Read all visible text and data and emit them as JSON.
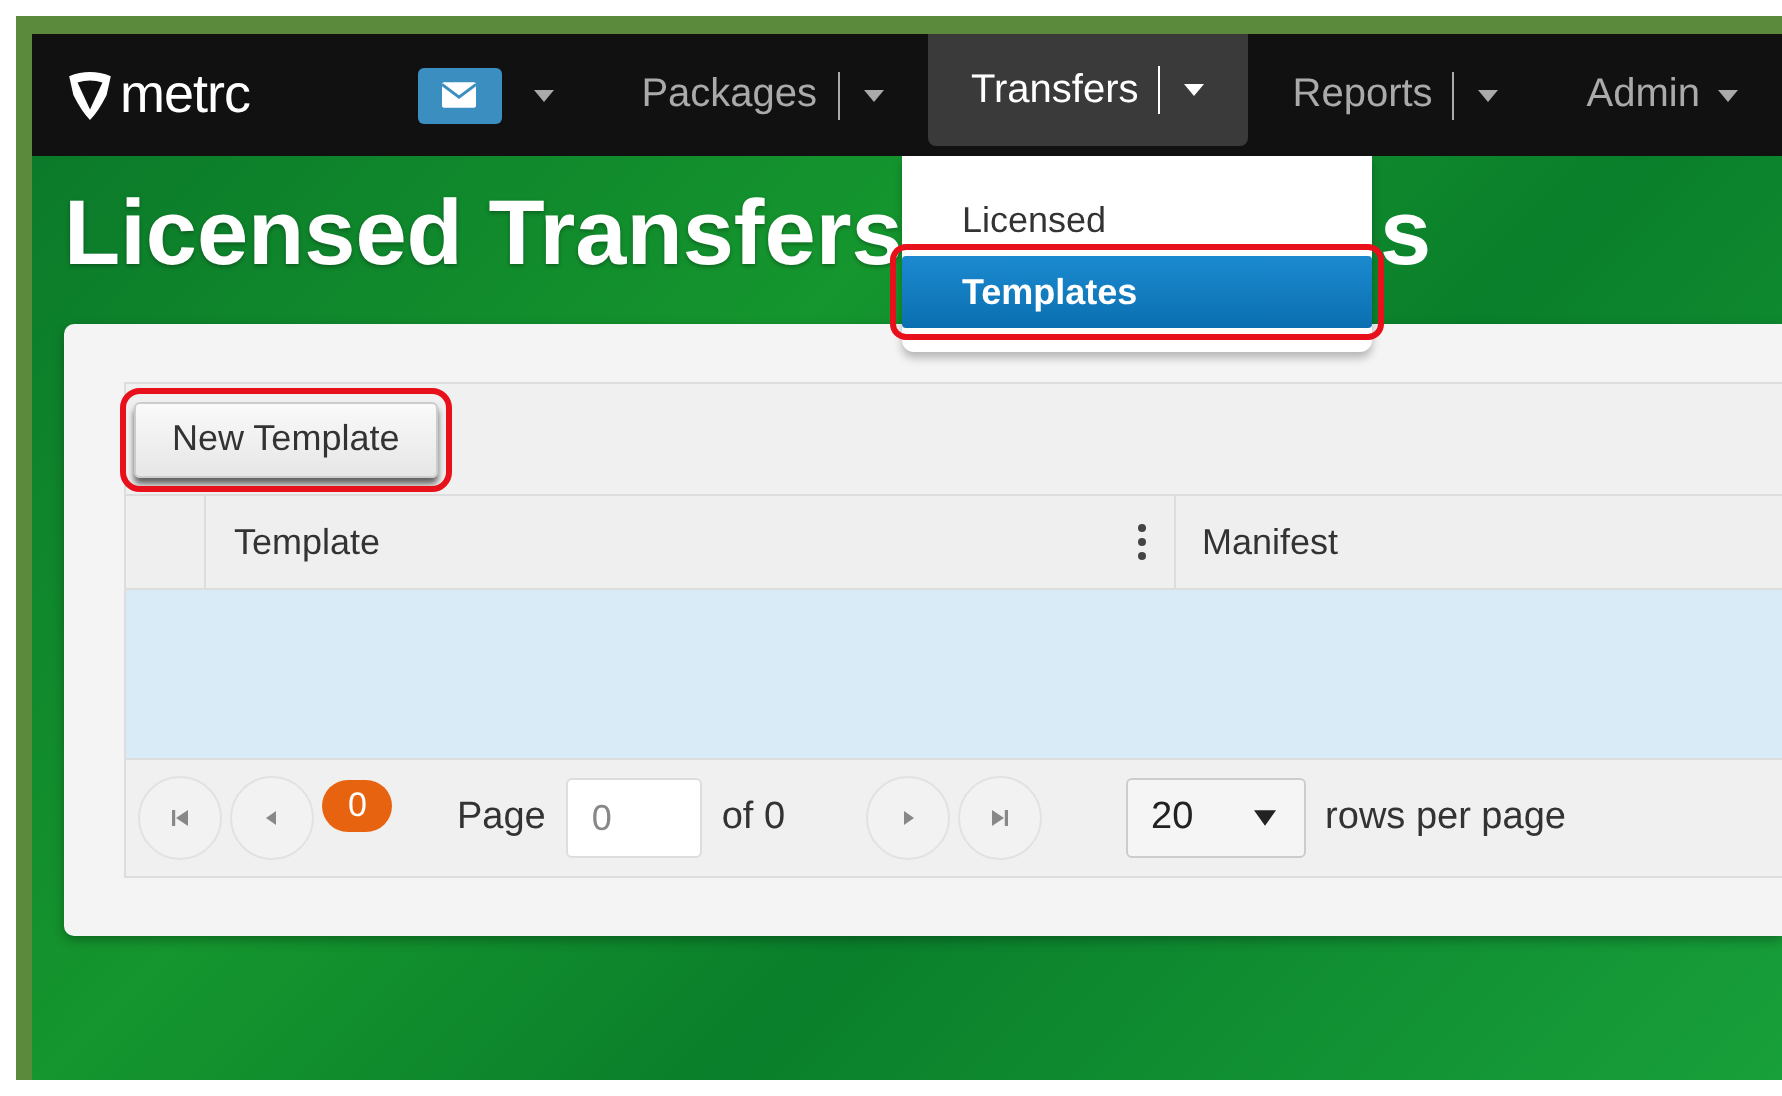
{
  "navbar": {
    "logo": "metrc",
    "items": [
      {
        "kind": "mail"
      },
      {
        "kind": "menu",
        "label": "Packages",
        "has_split": true,
        "selected": false
      },
      {
        "kind": "menu",
        "label": "Transfers",
        "has_split": true,
        "selected": true
      },
      {
        "kind": "menu",
        "label": "Reports",
        "has_split": true,
        "selected": false
      },
      {
        "kind": "menu",
        "label": "Admin",
        "has_split": false,
        "selected": false
      }
    ]
  },
  "dropdown": {
    "items": [
      {
        "label": "Licensed",
        "selected": false,
        "highlighted": false
      },
      {
        "label": "Templates",
        "selected": true,
        "highlighted": true
      }
    ]
  },
  "page_title": "Licensed Transfers",
  "page_title_tail": "s",
  "toolbar": {
    "button": {
      "label": "New Template",
      "highlighted": true
    }
  },
  "table": {
    "columns": [
      {
        "label": "Template",
        "menu": true
      },
      {
        "label": "Manifest",
        "menu": false
      }
    ]
  },
  "pager": {
    "count": "0",
    "page_label": "Page",
    "page_value": "0",
    "of_label": "of 0",
    "page_size": "20",
    "rows_label": "rows per page"
  }
}
